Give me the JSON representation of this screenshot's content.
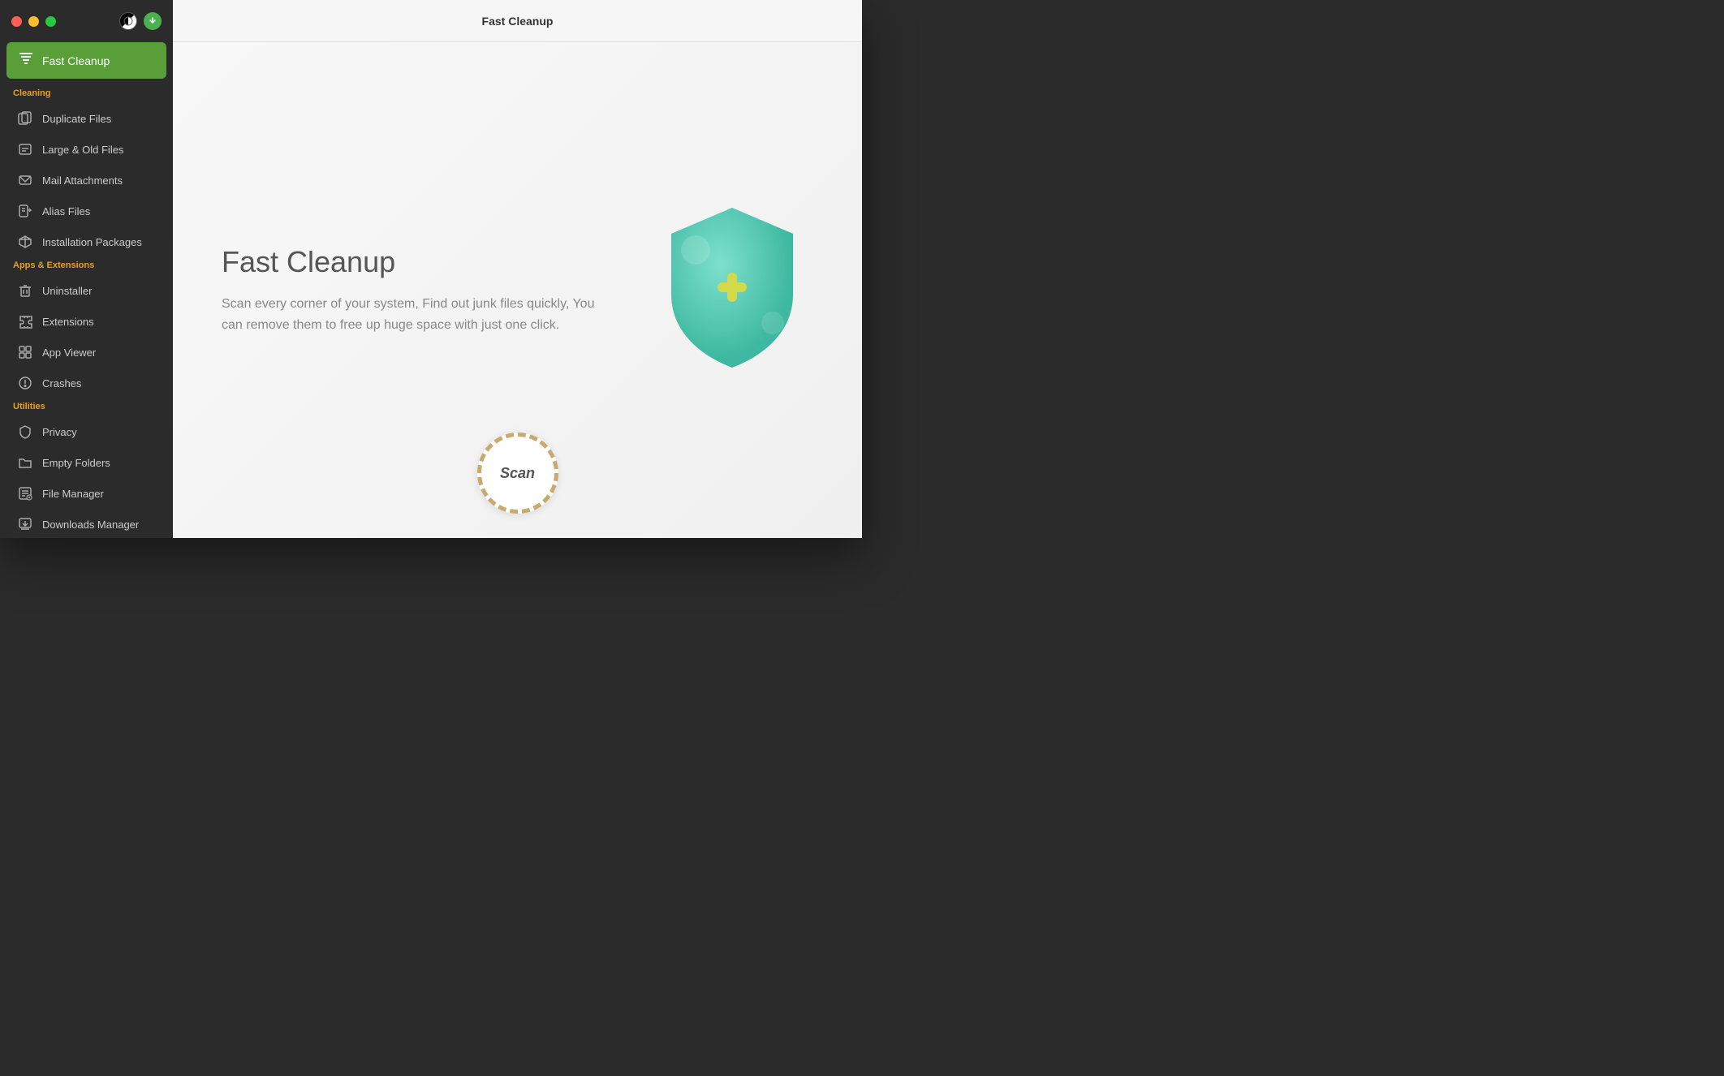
{
  "window": {
    "title": "Fast Cleanup",
    "traffic_lights": [
      "close",
      "minimize",
      "maximize"
    ]
  },
  "sidebar": {
    "active_item": "fast-cleanup",
    "fast_cleanup_label": "Fast Cleanup",
    "sections": [
      {
        "id": "cleaning",
        "label": "Cleaning",
        "items": [
          {
            "id": "duplicate-files",
            "label": "Duplicate Files",
            "icon": "duplicate"
          },
          {
            "id": "large-old-files",
            "label": "Large & Old Files",
            "icon": "large-files"
          },
          {
            "id": "mail-attachments",
            "label": "Mail Attachments",
            "icon": "mail"
          },
          {
            "id": "alias-files",
            "label": "Alias Files",
            "icon": "alias"
          },
          {
            "id": "installation-packages",
            "label": "Installation Packages",
            "icon": "package"
          }
        ]
      },
      {
        "id": "apps-extensions",
        "label": "Apps & Extensions",
        "items": [
          {
            "id": "uninstaller",
            "label": "Uninstaller",
            "icon": "trash"
          },
          {
            "id": "extensions",
            "label": "Extensions",
            "icon": "puzzle"
          },
          {
            "id": "app-viewer",
            "label": "App Viewer",
            "icon": "app-viewer"
          },
          {
            "id": "crashes",
            "label": "Crashes",
            "icon": "crash"
          }
        ]
      },
      {
        "id": "utilities",
        "label": "Utilities",
        "items": [
          {
            "id": "privacy",
            "label": "Privacy",
            "icon": "privacy"
          },
          {
            "id": "empty-folders",
            "label": "Empty Folders",
            "icon": "folder"
          },
          {
            "id": "file-manager",
            "label": "File Manager",
            "icon": "file-manager"
          },
          {
            "id": "downloads-manager",
            "label": "Downloads Manager",
            "icon": "downloads"
          }
        ]
      }
    ]
  },
  "main": {
    "header_title": "Fast Cleanup",
    "feature_title": "Fast Cleanup",
    "feature_desc": "Scan every corner of your system, Find out junk files quickly, You can remove them to free up huge space with just one click.",
    "scan_button_label": "Scan"
  },
  "colors": {
    "active_bg": "#5a9e3a",
    "cleaning_header": "#e8a020",
    "utilities_header": "#e8a020",
    "apps_header": "#e8a020",
    "shield_fill": "#52c5b0",
    "shield_plus": "#d4d94a",
    "scan_border": "#c9a96e"
  }
}
